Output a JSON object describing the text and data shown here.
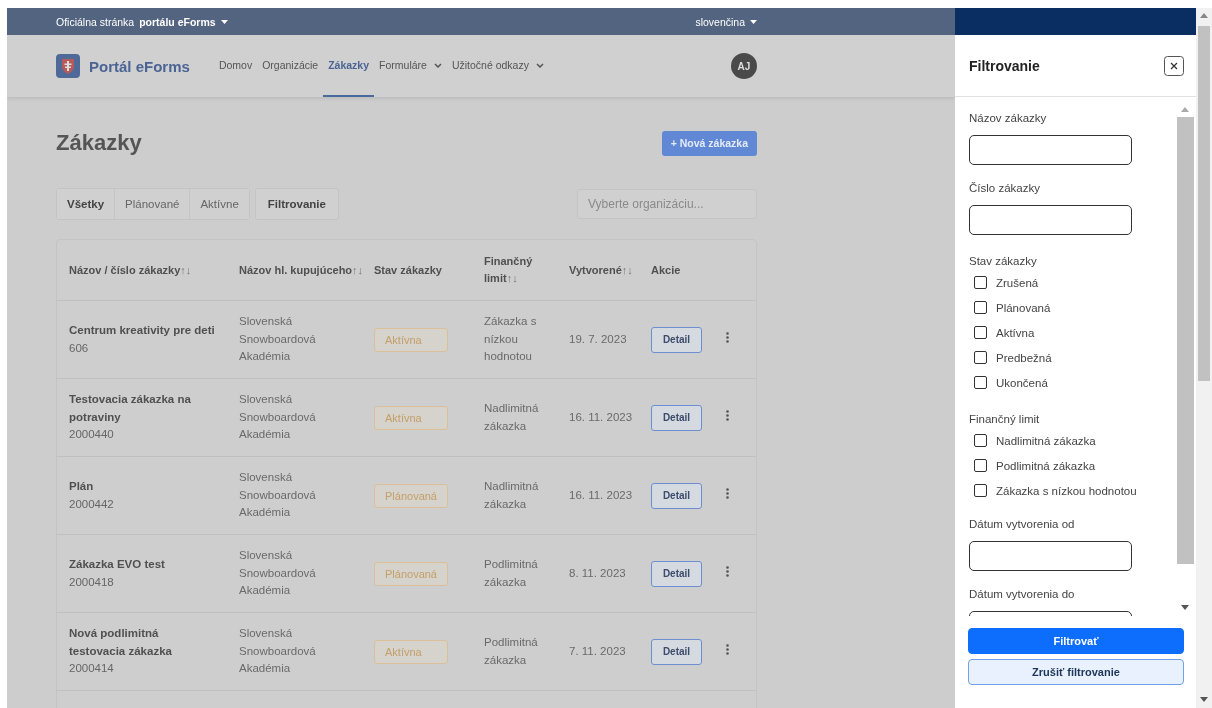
{
  "top_bar": {
    "site_text": "Oficiálna stránka **portálu eForms**",
    "language": "slovenčina"
  },
  "navbar": {
    "brand": "Portál eForms",
    "avatar": "AJ",
    "items": [
      {
        "label": "Domov",
        "selected": false,
        "dropdown": false
      },
      {
        "label": "Organizácie",
        "selected": false,
        "dropdown": false
      },
      {
        "label": "Zákazky",
        "selected": true,
        "dropdown": false
      },
      {
        "label": "Formuláre",
        "selected": false,
        "dropdown": true
      },
      {
        "label": "Užitočné odkazy",
        "selected": false,
        "dropdown": true
      }
    ]
  },
  "page": {
    "title": "Zákazky",
    "new_button": "+ Nová zákazka",
    "filter_button": "Filtrovanie",
    "org_select": {
      "placeholder": "Vyberte organizáciu..."
    },
    "tabs": [
      {
        "label": "Všetky",
        "selected": true
      },
      {
        "label": "Plánované",
        "selected": false
      },
      {
        "label": "Aktívne",
        "selected": false
      }
    ]
  },
  "table": {
    "columns": [
      {
        "label": "Názov / číslo zákazky",
        "sort": "↑↓"
      },
      {
        "label": "Názov hl. kupujúceho",
        "sort": "↑↓"
      },
      {
        "label": "Stav zákazky"
      },
      {
        "label": "Finančný limit",
        "sort": "↑↓"
      },
      {
        "label": "Vytvorené",
        "sort": "↑↓"
      },
      {
        "label": "Akcie"
      }
    ],
    "rows": [
      {
        "name": "Centrum kreativity pre deti",
        "number": "606",
        "buyer": "Slovenská Snowboardová Akadémia",
        "status": "Aktívna",
        "limit": "Zákazka s nízkou hodnotou",
        "created": "19. 7. 2023",
        "action": "Detail"
      },
      {
        "name": "Testovacia zákazka na potraviny",
        "number": "2000440",
        "buyer": "Slovenská Snowboardová Akadémia",
        "status": "Aktívna",
        "limit": "Nadlimitná zákazka",
        "created": "16. 11. 2023",
        "action": "Detail"
      },
      {
        "name": "Plán",
        "number": "2000442",
        "buyer": "Slovenská Snowboardová Akadémia",
        "status": "Plánovaná",
        "limit": "Nadlimitná zákazka",
        "created": "16. 11. 2023",
        "action": "Detail"
      },
      {
        "name": "Zákazka EVO test",
        "number": "2000418",
        "buyer": "Slovenská Snowboardová Akadémia",
        "status": "Plánovaná",
        "limit": "Podlimitná zákazka",
        "created": "8. 11. 2023",
        "action": "Detail"
      },
      {
        "name": "Nová podlimitná testovacia zákazka",
        "number": "2000414",
        "buyer": "Slovenská Snowboardová Akadémia",
        "status": "Aktívna",
        "limit": "Podlimitná zákazka",
        "created": "7. 11. 2023",
        "action": "Detail"
      }
    ]
  },
  "drawer": {
    "title": "Filtrovanie",
    "sections": [
      {
        "kind": "input",
        "label": "Názov zákazky"
      },
      {
        "kind": "input",
        "label": "Číslo zákazky"
      },
      {
        "kind": "checkboxes",
        "label": "Stav zákazky",
        "options": [
          {
            "label": "Zrušená",
            "checked": false
          },
          {
            "label": "Plánovaná",
            "checked": false
          },
          {
            "label": "Aktívna",
            "checked": false
          },
          {
            "label": "Predbežná",
            "checked": false
          },
          {
            "label": "Ukončená",
            "checked": false
          }
        ]
      },
      {
        "kind": "checkboxes",
        "label": "Finančný limit",
        "options": [
          {
            "label": "Nadlimitná zákazka",
            "checked": false
          },
          {
            "label": "Podlimitná zákazka",
            "checked": false
          },
          {
            "label": "Zákazka s nízkou hodnotou",
            "checked": false
          }
        ]
      },
      {
        "kind": "input",
        "label": "Dátum vytvorenia od"
      },
      {
        "kind": "input",
        "label": "Dátum vytvorenia do"
      }
    ],
    "buttons": [
      {
        "label": "Filtrovať",
        "kind": "primary"
      },
      {
        "label": "Zrušiť filtrovanie",
        "kind": "secondary"
      }
    ]
  }
}
